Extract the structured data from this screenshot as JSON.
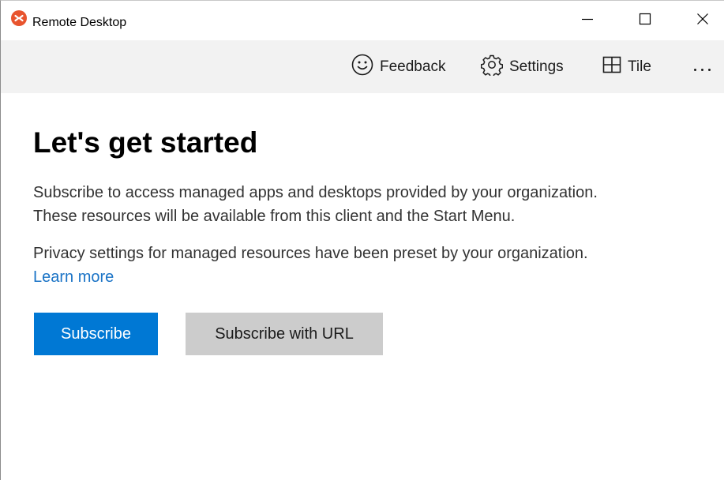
{
  "window": {
    "title": "Remote Desktop",
    "app_icon": "remote-desktop-logo-icon",
    "controls": {
      "minimize_icon": "minimize-icon",
      "maximize_icon": "maximize-icon",
      "close_icon": "close-icon"
    }
  },
  "commandbar": {
    "feedback": {
      "label": "Feedback",
      "icon": "smiley-icon"
    },
    "settings": {
      "label": "Settings",
      "icon": "gear-icon"
    },
    "tile": {
      "label": "Tile",
      "icon": "tile-grid-icon"
    },
    "more": {
      "icon": "more-ellipsis-icon"
    }
  },
  "main": {
    "heading": "Let's get started",
    "paragraph1_line1": "Subscribe to access managed apps and desktops provided by your organization.",
    "paragraph1_line2": "These resources will be available from this client and the Start Menu.",
    "paragraph2": "Privacy settings for managed resources have been preset by your organization.",
    "learn_more": "Learn more",
    "subscribe_label": "Subscribe",
    "subscribe_url_label": "Subscribe with URL"
  },
  "colors": {
    "accent": "#0078d4",
    "link": "#1a73c6",
    "secondary_button": "#cccccc",
    "commandbar_bg": "#f2f2f2",
    "logo_red": "#e8542e"
  }
}
